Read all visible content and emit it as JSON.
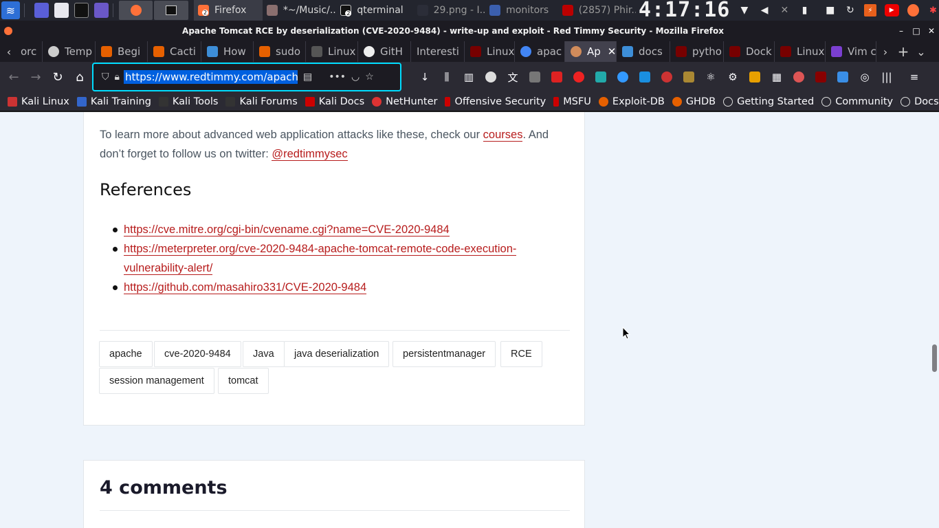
{
  "taskbar": {
    "tasks": [
      {
        "label": "Firefox",
        "count": "2"
      },
      {
        "label": "*~/Music/..."
      },
      {
        "label": "qterminal",
        "count": "2"
      },
      {
        "label": "29.png - I..."
      },
      {
        "label": "monitors"
      },
      {
        "label": "(2857) Phir..."
      }
    ],
    "clock": "4:17:16"
  },
  "window": {
    "title": "Apache Tomcat RCE by deserialization (CVE-2020-9484) - write-up and exploit - Red Timmy Security - Mozilla Firefox"
  },
  "tabs": [
    {
      "label": "orc",
      "color": "#777777"
    },
    {
      "label": "Temp",
      "color": "#cccccc"
    },
    {
      "label": "Begi",
      "color": "#e66000"
    },
    {
      "label": "Cacti",
      "color": "#e66000"
    },
    {
      "label": "How",
      "color": "#3d8ed8"
    },
    {
      "label": "sudo",
      "color": "#e66000"
    },
    {
      "label": "Linux",
      "color": "#444444"
    },
    {
      "label": "GitH",
      "color": "#ffffff"
    },
    {
      "label": "Interesti",
      "color": ""
    },
    {
      "label": "Linux",
      "color": "#c00000"
    },
    {
      "label": "apac",
      "color": "#4285f4"
    },
    {
      "label": "Ap",
      "color": "#d18c5b"
    },
    {
      "label": "docs",
      "color": "#3d8ed8"
    },
    {
      "label": "pytho",
      "color": "#c00000"
    },
    {
      "label": "Dock",
      "color": "#c00000"
    },
    {
      "label": "Linux",
      "color": "#c00000"
    },
    {
      "label": "Vim c",
      "color": "#7b3fd1"
    }
  ],
  "urlbar": {
    "url": "https://www.redtimmy.com/apache-"
  },
  "bookmarks": [
    {
      "label": "Kali Linux",
      "color": "#d33"
    },
    {
      "label": "Kali Training",
      "color": "#3366cc"
    },
    {
      "label": "Kali Tools",
      "color": "#222"
    },
    {
      "label": "Kali Forums",
      "color": "#222"
    },
    {
      "label": "Kali Docs",
      "color": "#c00"
    },
    {
      "label": "NetHunter",
      "color": "#d33"
    },
    {
      "label": "Offensive Security",
      "color": "#c00"
    },
    {
      "label": "MSFU",
      "color": "#c00"
    },
    {
      "label": "Exploit-DB",
      "color": "#e66000"
    },
    {
      "label": "GHDB",
      "color": "#e66000"
    },
    {
      "label": "Getting Started",
      "color": ""
    },
    {
      "label": "Community",
      "color": ""
    },
    {
      "label": "Docs",
      "color": ""
    }
  ],
  "article": {
    "cta_before": "To learn more about advanced web application attacks like these, check our ",
    "cta_link": "courses",
    "cta_mid": ". And",
    "cta_line2": "don’t forget to follow us on twitter: ",
    "cta_twitter": "@redtimmysec",
    "references_heading": "References",
    "references": [
      {
        "line1": "https://cve.mitre.org/cgi-bin/cvename.cgi?name=CVE-2020-9484",
        "line2": ""
      },
      {
        "line1": "https://meterpreter.org/cve-2020-9484-apache-tomcat-remote-code-execution-",
        "line2": "vulnerability-alert/"
      },
      {
        "line1": "https://github.com/masahiro331/CVE-2020-9484",
        "line2": ""
      }
    ],
    "tags": [
      "apache",
      "cve-2020-9484",
      "Java",
      "java deserialization",
      "persistentmanager",
      "RCE",
      "session management",
      "tomcat"
    ]
  },
  "comments": {
    "heading": "4 comments"
  }
}
